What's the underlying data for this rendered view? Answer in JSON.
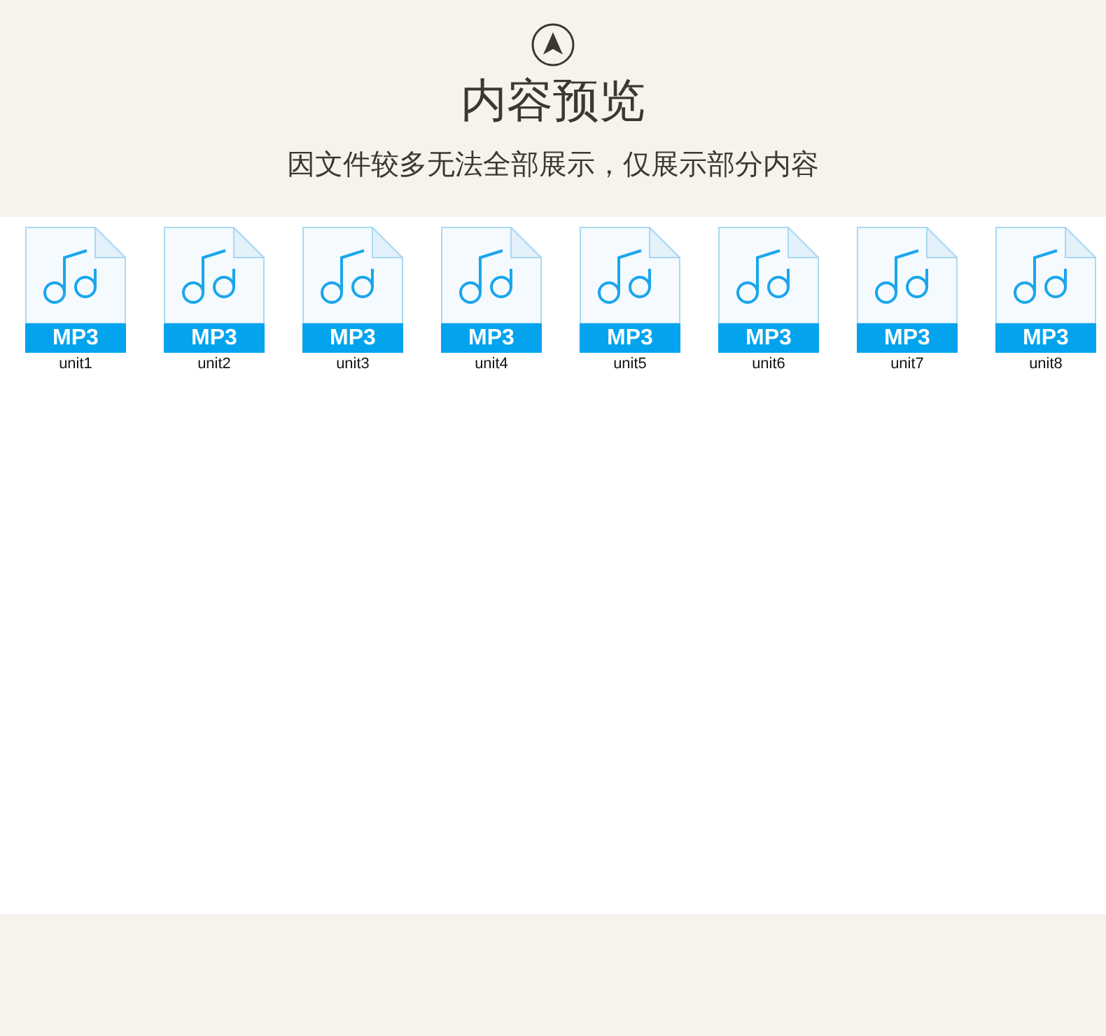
{
  "header": {
    "title": "内容预览",
    "subtitle": "因文件较多无法全部展示，仅展示部分内容"
  },
  "files": [
    {
      "type": "MP3",
      "name": "unit1"
    },
    {
      "type": "MP3",
      "name": "unit2"
    },
    {
      "type": "MP3",
      "name": "unit3"
    },
    {
      "type": "MP3",
      "name": "unit4"
    },
    {
      "type": "MP3",
      "name": "unit5"
    },
    {
      "type": "MP3",
      "name": "unit6"
    },
    {
      "type": "MP3",
      "name": "unit7"
    },
    {
      "type": "MP3",
      "name": "unit8"
    }
  ]
}
